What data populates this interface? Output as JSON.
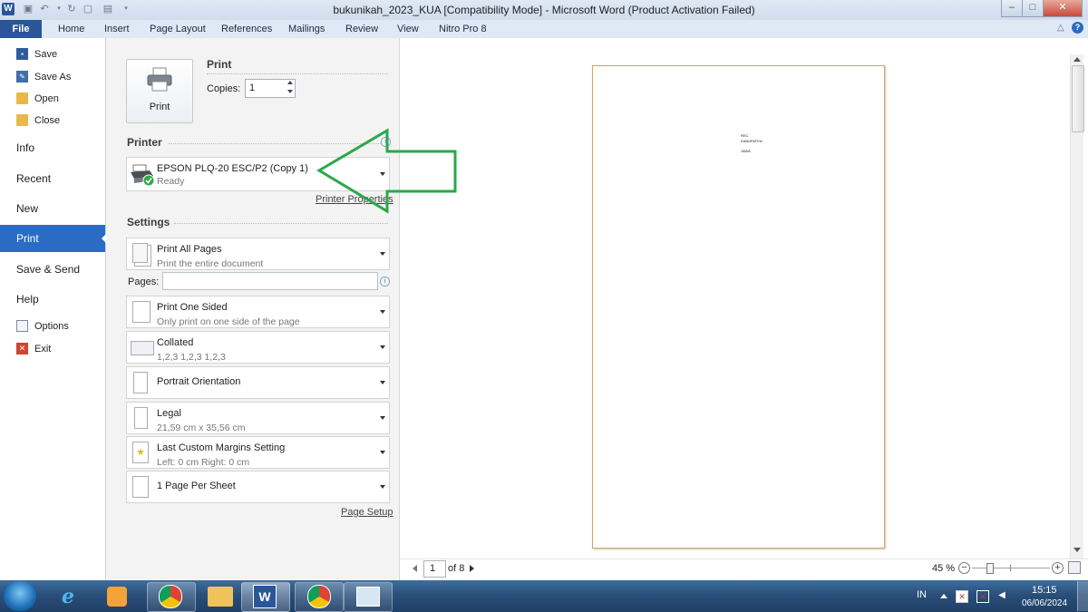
{
  "window": {
    "title": "bukunikah_2023_KUA [Compatibility Mode]  -  Microsoft Word (Product Activation Failed)",
    "app_icon_letter": "W",
    "minimize": "–",
    "maximize": "□",
    "close": "✕"
  },
  "ribbon": {
    "tabs": [
      "File",
      "Home",
      "Insert",
      "Page Layout",
      "References",
      "Mailings",
      "Review",
      "View",
      "Nitro Pro 8"
    ],
    "help_icon": "?",
    "collapse_icon": "△"
  },
  "nav": {
    "save": "Save",
    "save_as": "Save As",
    "open": "Open",
    "close": "Close",
    "info": "Info",
    "recent": "Recent",
    "new": "New",
    "print": "Print",
    "save_send": "Save & Send",
    "help": "Help",
    "options": "Options",
    "exit": "Exit"
  },
  "print": {
    "heading": "Print",
    "button_label": "Print",
    "copies_label": "Copies:",
    "copies_value": "1"
  },
  "printer": {
    "heading": "Printer",
    "name": "EPSON PLQ-20 ESC/P2 (Copy 1)",
    "status": "Ready",
    "properties_link": "Printer Properties",
    "info_icon": "i"
  },
  "settings": {
    "heading": "Settings",
    "pages_label": "Pages:",
    "pages_value": "",
    "info_icon": "i",
    "items": [
      {
        "main": "Print All Pages",
        "sub": "Print the entire document"
      },
      {
        "main": "Print One Sided",
        "sub": "Only print on one side of the page"
      },
      {
        "main": "Collated",
        "sub": "1,2,3    1,2,3    1,2,3"
      },
      {
        "main": "Portrait Orientation",
        "sub": ""
      },
      {
        "main": "Legal",
        "sub": "21,59 cm x 35,56 cm"
      },
      {
        "main": "Last Custom Margins Setting",
        "sub": "Left:  0 cm    Right:  0 cm"
      },
      {
        "main": "1 Page Per Sheet",
        "sub": ""
      }
    ],
    "page_setup_link": "Page Setup"
  },
  "preview": {
    "page_lines": [
      "REC",
      "KABUPATEN",
      "JAWA"
    ],
    "current_page": "1",
    "of_pages": "of 8",
    "zoom": "45 %",
    "zoom_level_percent": 45
  },
  "taskbar": {
    "language": "IN",
    "time": "15:15",
    "date": "06/06/2024"
  },
  "colors": {
    "accent": "#2a6cc4",
    "file_tab": "#2a5699",
    "annotation_arrow": "#2aa84a"
  }
}
